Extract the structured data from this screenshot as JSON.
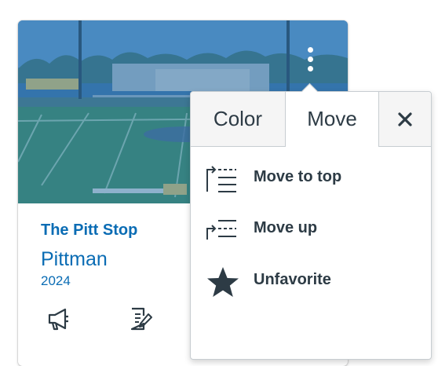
{
  "course_card": {
    "name": "The Pitt Stop",
    "code": "Pittman",
    "term": "2024",
    "hero_overlay_color": "#2469a5",
    "actions": [
      {
        "icon": "announcements-megaphone-icon"
      },
      {
        "icon": "assignments-edit-icon"
      }
    ]
  },
  "menu": {
    "tabs": [
      {
        "label": "Color"
      },
      {
        "label": "Move"
      }
    ],
    "active_tab": "Move",
    "close_icon": "close-icon",
    "items": [
      {
        "label": "Move to top",
        "icon": "move-to-top-icon"
      },
      {
        "label": "Move up",
        "icon": "move-up-icon"
      },
      {
        "label": "Unfavorite",
        "icon": "star-icon"
      }
    ]
  },
  "colors": {
    "link_blue": "#0a6cb4",
    "text_dark": "#2d3b45",
    "border": "#c7cdd1"
  }
}
